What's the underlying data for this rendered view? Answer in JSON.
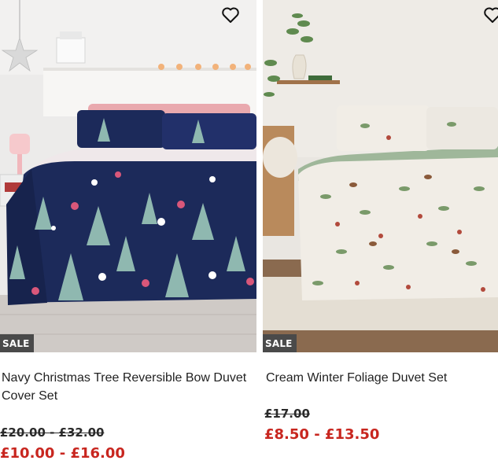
{
  "products": [
    {
      "badge": "SALE",
      "title_line1": "Navy Christmas Tree Reversible Bow Duvet",
      "title_line2": "Cover Set",
      "was_price": "£20.00 - £32.00",
      "now_price": "£10.00 - £16.00",
      "wishlist_icon": "heart-outline-icon"
    },
    {
      "badge": "SALE",
      "title_line1": "Cream Winter Foliage Duvet Set",
      "was_price": "£17.00",
      "now_price": "£8.50 - £13.50",
      "wishlist_icon": "heart-outline-icon"
    }
  ],
  "colors": {
    "sale_badge_bg": "#4a4a4a",
    "now_price": "#c8261f",
    "navy_duvet": "#1c2a5a",
    "cream_duvet": "#f1ede6"
  }
}
